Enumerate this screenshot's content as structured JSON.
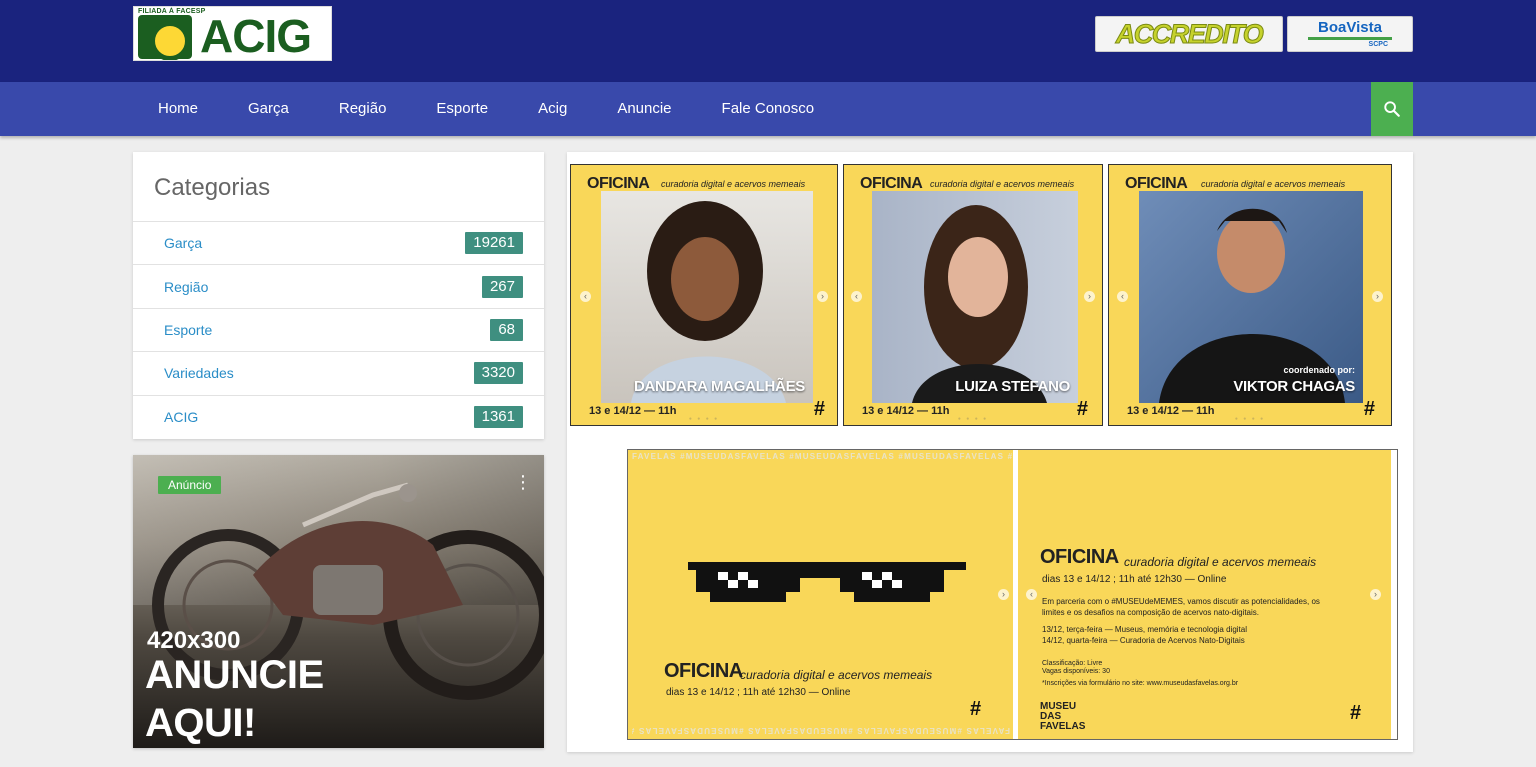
{
  "header": {
    "logo_text": "ACIG",
    "logo_tagline": "FILIADA À FACESP",
    "partners": {
      "accredito": "ACCREDITO",
      "boavista": "BoaVista",
      "boavista_sub": "SCPC"
    }
  },
  "nav": {
    "items": [
      "Home",
      "Garça",
      "Região",
      "Esporte",
      "Acig",
      "Anuncie",
      "Fale Conosco"
    ],
    "search_icon": "search-icon"
  },
  "categories": {
    "title": "Categorias",
    "items": [
      {
        "name": "Garça",
        "count": "19261"
      },
      {
        "name": "Região",
        "count": "267"
      },
      {
        "name": "Esporte",
        "count": "68"
      },
      {
        "name": "Variedades",
        "count": "3320"
      },
      {
        "name": "ACIG",
        "count": "1361"
      }
    ]
  },
  "ad": {
    "badge": "Anúncio",
    "size": "420x300",
    "line1": "ANUNCIE",
    "line2": "AQUI!"
  },
  "posts": {
    "heading": "OFICINA",
    "subtitle": "curadoria digital e acervos memeais",
    "date": "13 e 14/12 — 11h",
    "hash": "#",
    "people": [
      {
        "name": "DANDARA MAGALHÃES"
      },
      {
        "name": "LUIZA STEFANO"
      },
      {
        "name": "VIKTOR CHAGAS",
        "role": "coordenado por:"
      }
    ]
  },
  "lower": {
    "border_text": "FAVELAS #MUSEUDASFAVELAS #MUSEUDASFAVELAS #MUSEUDASFAVELAS #MUSEUDA",
    "heading": "OFICINA",
    "subtitle": "curadoria digital e acervos memeais",
    "schedule": "dias 13 e 14/12 ; 11h até 12h30 — Online",
    "schedule_right": "dias 13 e 14/12 ; 11h até 12h30 — Online",
    "intro": "Em parceria com o #MUSEUdeMEMES, vamos discutir as potencialidades, os limites e os desafios na composição de acervos nato-digitais.",
    "day1": "13/12, terça-feira — Museus, memória e tecnologia digital",
    "day2": "14/12, quarta-feira — Curadoria de Acervos Nato-Digitais",
    "classification": "Classificação: Livre",
    "vacancies": "Vagas disponíveis: 30",
    "inscriptions": "*Inscrições via formulário no site: www.museudasfavelas.org.br",
    "museum": "MUSEU DAS FAVELAS",
    "hash": "#"
  },
  "colors": {
    "header_bg": "#1a237e",
    "nav_bg": "#3949ab",
    "search_bg": "#4caf50",
    "count_bg": "#3f8f80",
    "link": "#2a8dc7",
    "poster_yellow": "#f9d759"
  }
}
